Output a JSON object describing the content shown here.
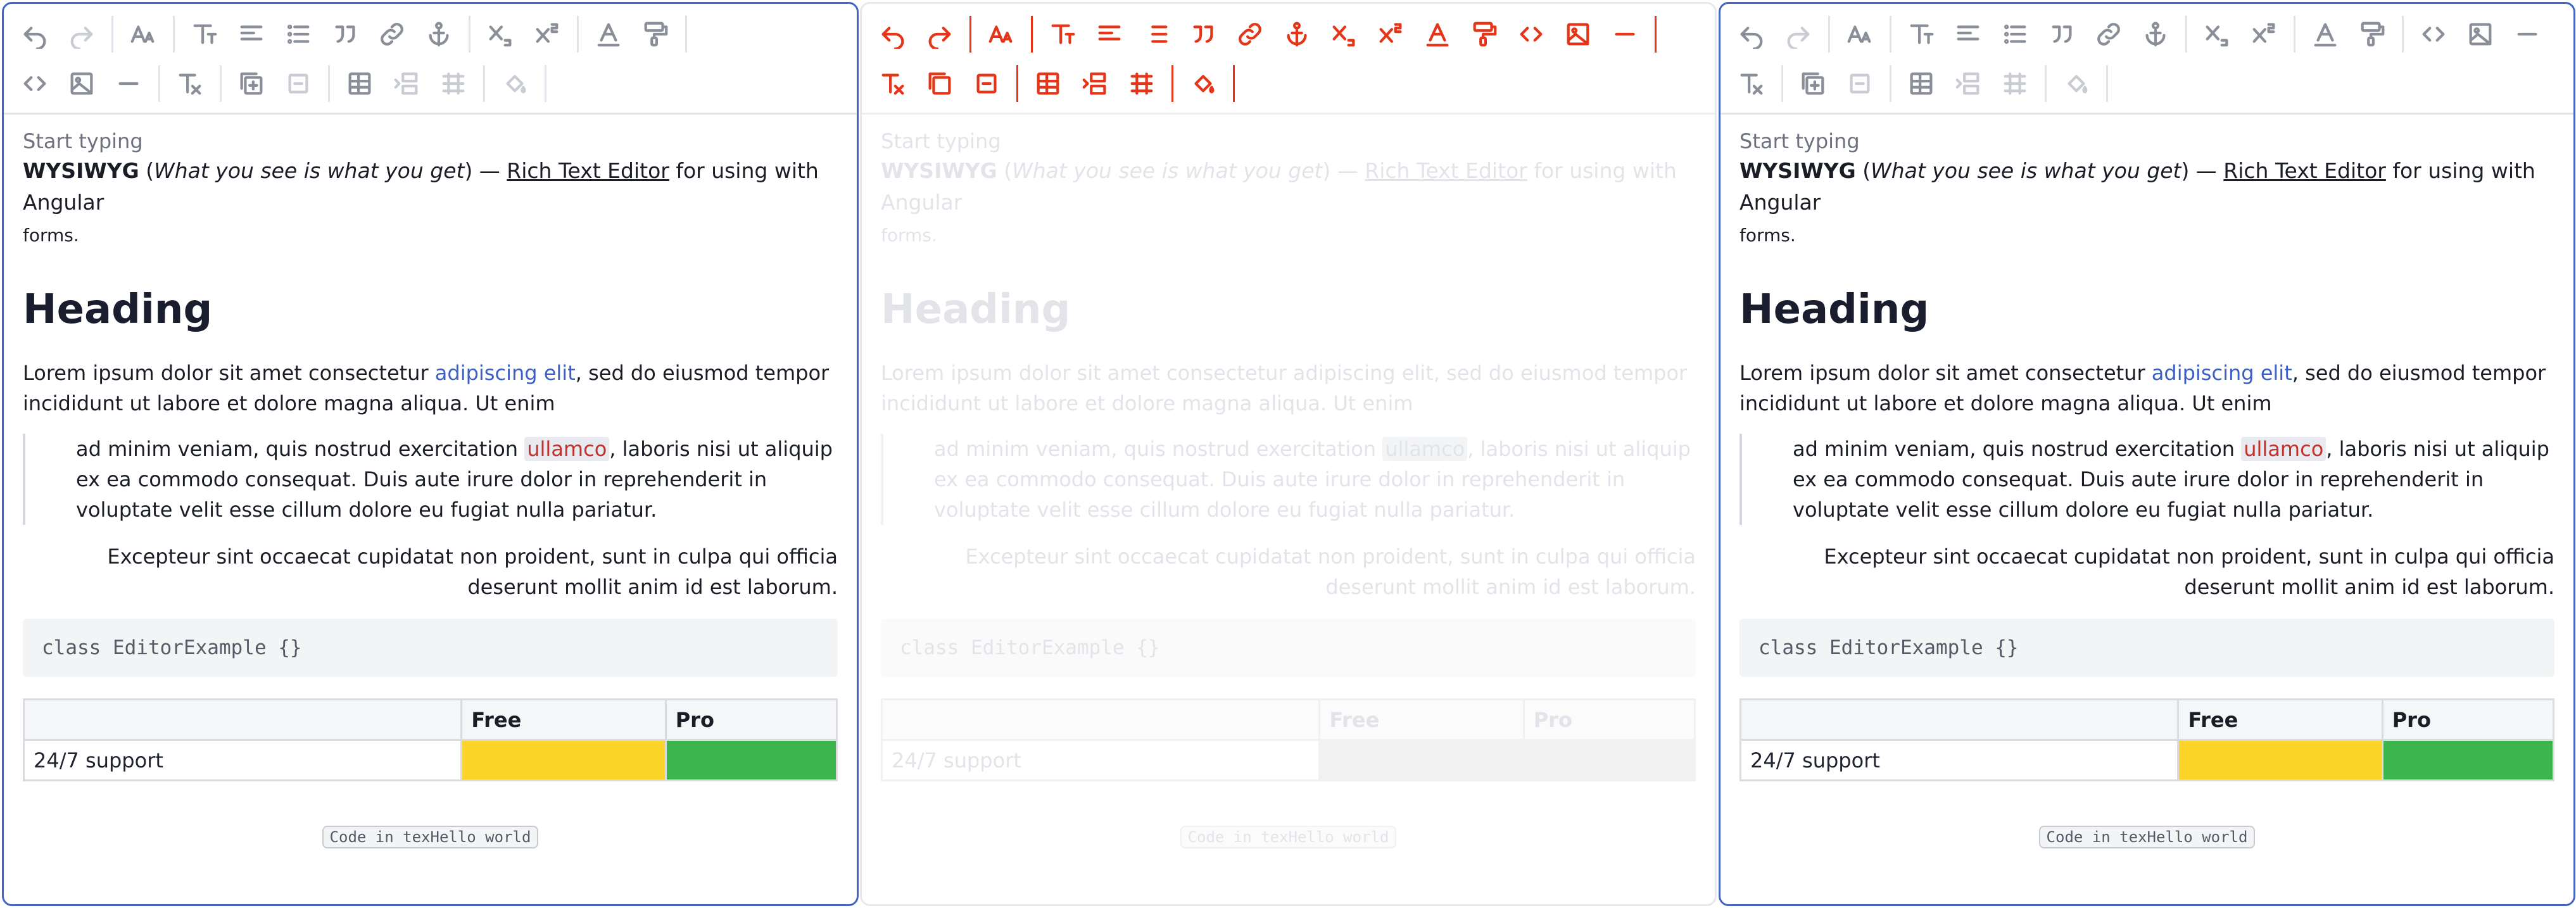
{
  "editor": {
    "placeholder": "Start typing",
    "intro_bold": "WYSIWYG",
    "intro_paren_open": " (",
    "intro_italic": "What you see is what you get",
    "intro_paren_close": ") — ",
    "intro_link": "Rich Text Editor",
    "intro_tail": " for using with Angular",
    "intro_tail2": "forms.",
    "heading": "Heading",
    "para_start": "Lorem ipsum dolor sit amet consectetur ",
    "para_link": "adipiscing elit",
    "para_end": ", sed do eiusmod tempor incididunt ut labore et dolore magna aliqua. Ut enim",
    "quote_start": "ad minim veniam, quis nostrud exercitation ",
    "quote_highlight": "ullamco",
    "quote_end": ", laboris nisi ut aliquip ex ea commodo consequat. Duis aute irure dolor in reprehenderit in voluptate velit esse cillum dolore eu fugiat nulla pariatur.",
    "right_text": "Excepteur sint occaecat cupidatat non proident, sunt in culpa qui officia deserunt mollit anim id est laborum.",
    "code_block": "class EditorExample {}",
    "table": {
      "headers": [
        "",
        "Free",
        "Pro"
      ],
      "row_label": "24/7 support"
    },
    "footer_code": "Code in texHello world"
  },
  "toolbar": {
    "row1": [
      "undo-icon",
      "redo-icon",
      "font-size-icon",
      "text-style-icon",
      "align-icon",
      "list-icon",
      "quote-icon",
      "link-icon",
      "anchor-icon",
      "subscript-icon",
      "superscript-icon",
      "text-color-icon",
      "paint-roller-icon"
    ],
    "row2": [
      "code-icon",
      "image-icon",
      "horizontal-rule-icon",
      "clear-format-icon",
      "insert-group-icon",
      "remove-group-icon",
      "table-icon",
      "table-row-icon",
      "table-cells-icon",
      "cell-color-icon"
    ]
  },
  "colors": {
    "accent": "#4466c2",
    "link": "#3b5fc4",
    "highlight_text": "#c0322b",
    "cell_yellow": "#fdd42a",
    "cell_green": "#3bb54c",
    "ghost_icons": "#e53417"
  }
}
